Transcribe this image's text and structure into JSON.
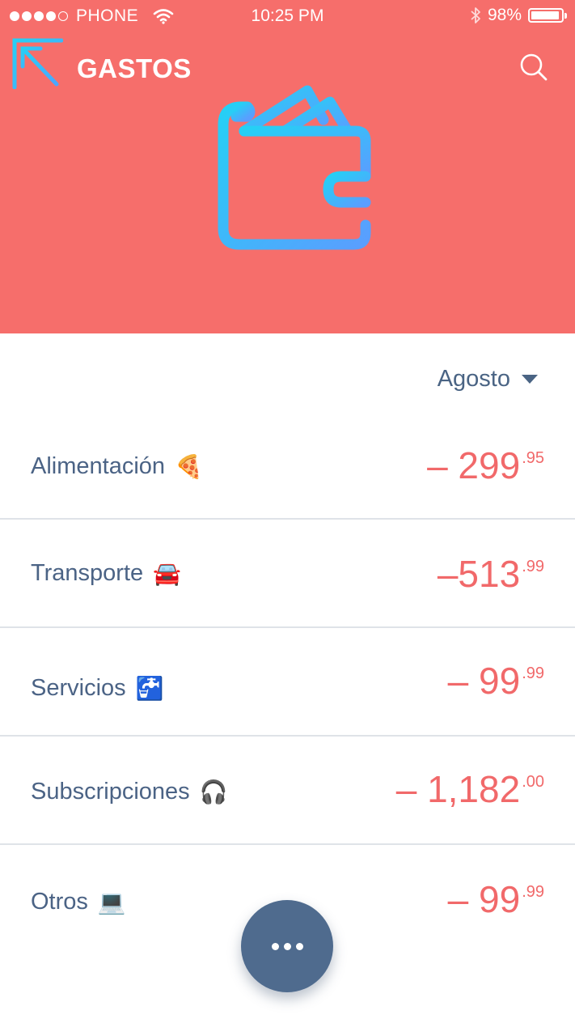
{
  "status_bar": {
    "carrier": "PHONE",
    "time": "10:25 PM",
    "battery": "98%"
  },
  "app": {
    "title": "GASTOS"
  },
  "icons": {
    "logo": "arrow-up-left-logo",
    "search": "search-icon",
    "hero": "wallet-icon"
  },
  "colors": {
    "header_bg": "#f66e6b",
    "accent_gradient_start": "#25d0f5",
    "accent_gradient_end": "#4da6ff",
    "text_primary": "#4b6385",
    "amount": "#f1696a",
    "fab": "#4f6b8e"
  },
  "month_selector": {
    "label": "Agosto"
  },
  "expenses": [
    {
      "name": "Alimentación",
      "emoji": "🍕",
      "amount": "– 299",
      "cents": ".95"
    },
    {
      "name": "Transporte",
      "emoji": "🚘",
      "amount": "–513",
      "cents": ".99"
    },
    {
      "name": "Servicios",
      "emoji": "🚰",
      "amount": "– 99",
      "cents": ".99"
    },
    {
      "name": "Subscripciones",
      "emoji": "🎧",
      "amount": "– 1,182",
      "cents": ".00"
    },
    {
      "name": "Otros",
      "emoji": "💻",
      "amount": "– 99",
      "cents": ".99"
    }
  ],
  "fab": {
    "icon": "more-horizontal-icon"
  }
}
